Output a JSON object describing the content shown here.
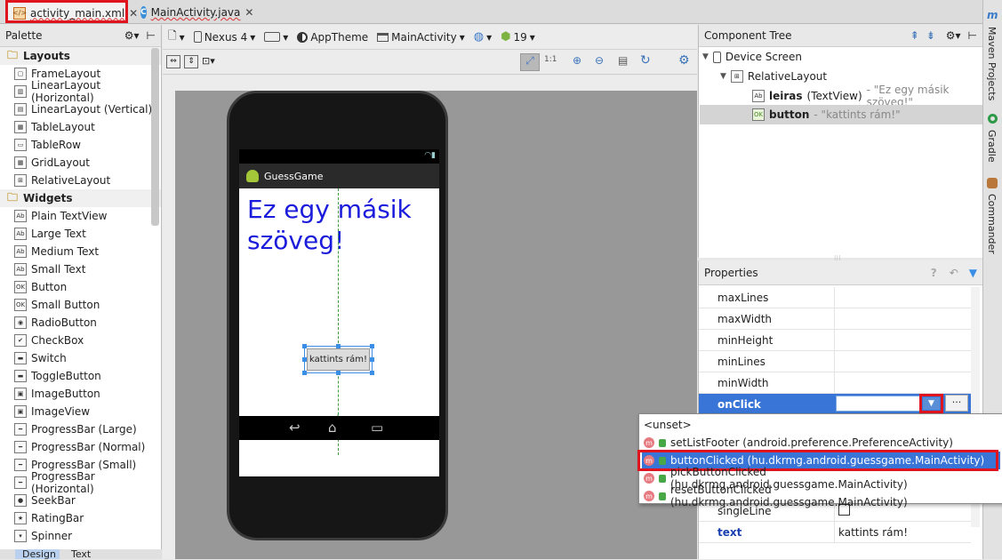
{
  "tabs": [
    {
      "label": "activity_main.xml",
      "active": true
    },
    {
      "label": "MainActivity.java",
      "active": false
    }
  ],
  "palette": {
    "title": "Palette",
    "categories": [
      {
        "name": "Layouts",
        "items": [
          "FrameLayout",
          "LinearLayout (Horizontal)",
          "LinearLayout (Vertical)",
          "TableLayout",
          "TableRow",
          "GridLayout",
          "RelativeLayout"
        ]
      },
      {
        "name": "Widgets",
        "items": [
          "Plain TextView",
          "Large Text",
          "Medium Text",
          "Small Text",
          "Button",
          "Small Button",
          "RadioButton",
          "CheckBox",
          "Switch",
          "ToggleButton",
          "ImageButton",
          "ImageView",
          "ProgressBar (Large)",
          "ProgressBar (Normal)",
          "ProgressBar (Small)",
          "ProgressBar (Horizontal)",
          "SeekBar",
          "RatingBar",
          "Spinner"
        ]
      }
    ],
    "bottom_tabs": [
      "Design",
      "Text"
    ]
  },
  "toolbar": {
    "device": "Nexus 4",
    "theme": "AppTheme",
    "activity": "MainActivity",
    "api": "19"
  },
  "preview": {
    "app_title": "GuessGame",
    "big_text": "Ez egy másik szöveg!",
    "button_text": "kattints rám!"
  },
  "component_tree": {
    "title": "Component Tree",
    "device": "Device Screen",
    "layout": "RelativeLayout",
    "textview": {
      "id": "leiras",
      "type": "(TextView)",
      "text": "- \"Ez egy másik szöveg!\""
    },
    "button": {
      "id": "button",
      "text": "- \"kattints rám!\""
    }
  },
  "properties": {
    "title": "Properties",
    "rows": [
      {
        "name": "maxLines",
        "value": ""
      },
      {
        "name": "maxWidth",
        "value": ""
      },
      {
        "name": "minHeight",
        "value": ""
      },
      {
        "name": "minLines",
        "value": ""
      },
      {
        "name": "minWidth",
        "value": ""
      },
      {
        "name": "onClick",
        "value": ""
      }
    ],
    "singleLine": "singleLine",
    "text_name": "text",
    "text_value": "kattints rám!"
  },
  "popup": {
    "unset": "<unset>",
    "items": [
      "setListFooter (android.preference.PreferenceActivity)",
      "buttonClicked (hu.dkrmg.android.guessgame.MainActivity)",
      "pickButtonClicked (hu.dkrmg.android.guessgame.MainActivity)",
      "resetButtonClicked (hu.dkrmg.android.guessgame.MainActivity)"
    ]
  },
  "side": {
    "maven": "Maven Projects",
    "gradle": "Gradle",
    "commander": "Commander"
  },
  "colors": {
    "highlight": "#3875d7",
    "red": "#e0141e",
    "preview_text": "#1b1bdc"
  }
}
